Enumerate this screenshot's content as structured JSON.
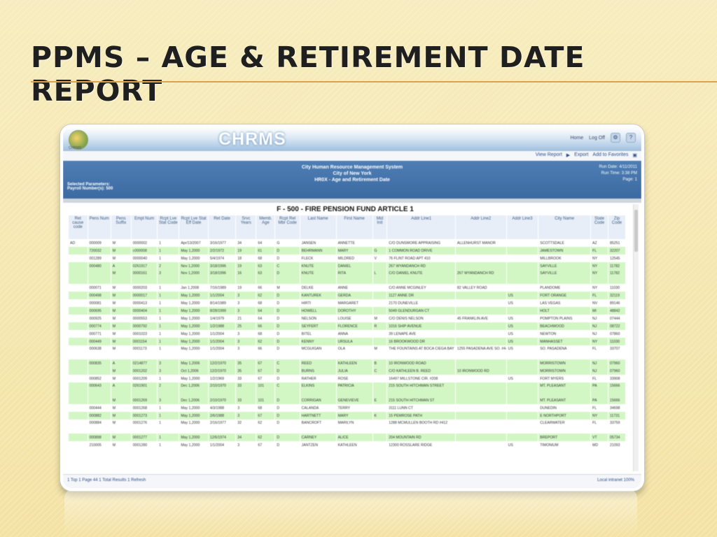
{
  "slide": {
    "title": "PPMS – AGE & RETIREMENT DATE REPORT"
  },
  "app": {
    "brand": "CHRMS",
    "logo_text": "CHRMS",
    "top_links": [
      "Home",
      "Log Off"
    ],
    "toolbar": {
      "view": "View Report",
      "export": "Export",
      "add_to_favorites": "Add to Favorites"
    },
    "header": {
      "line1": "City Human Resource Management System",
      "line2": "City of New York",
      "line3": "HR0X - Age and Retirement Date",
      "params_label": "Selected Parameters:",
      "payroll_label": "Payroll Number(s): 500",
      "run_date": "Run Date: 4/11/2011",
      "run_time": "Run Time: 3:38 PM",
      "page": "Page: 1"
    },
    "report_title": "F - 500 - FIRE PENSION FUND ARTICLE 1",
    "columns": [
      "Ret cause code",
      "Pens Num",
      "Pens Suffix",
      "Empl Num",
      "Rcpt Lve Stat Code",
      "Rcpt Lve Stat Eff Date",
      "Ret Date",
      "Srvc Years",
      "Memb. Age",
      "Rcpt Rel Mbr Code",
      "Last Name",
      "First Name",
      "Mid Init",
      "Addr Line1",
      "Addr Line2",
      "Addr Line3",
      "City Name",
      "State Code",
      "Zip Code"
    ],
    "rows": [
      {
        "style": "white",
        "cells": [
          "AD",
          "000009",
          "M",
          "0000002",
          "1",
          "Apr/13/2007",
          "3/16/1977",
          "34",
          "64",
          "G",
          "JANSEN",
          "ANNETTE",
          "",
          "C/O DUNSMORE APPRAISING",
          "ALLENHURST MANOR",
          "",
          "SCOTTSDALE",
          "AZ",
          "85251"
        ]
      },
      {
        "style": "green",
        "cells": [
          "",
          "720032",
          "M",
          "c000008",
          "1",
          "May 1,2000",
          "2/2/1972",
          "19",
          "61",
          "D",
          "BEHRMANN",
          "MARY",
          "G",
          "1 COMMON ROAD DRIVE",
          "",
          "",
          "JAMESTOWN",
          "FL",
          "32207"
        ]
      },
      {
        "style": "white",
        "cells": [
          "",
          "001289",
          "M",
          "0000040",
          "1",
          "May 1,2000",
          "5/4/1974",
          "18",
          "68",
          "D",
          "FLECK",
          "MILDRED",
          "V",
          "76 FLINT ROAD APT 410",
          "",
          "",
          "MILLBROOK",
          "NY",
          "12545"
        ]
      },
      {
        "style": "green",
        "cells": [
          "",
          "000480",
          "A",
          "0261917",
          "2",
          "Nov 1,2000",
          "3/18/1996",
          "19",
          "63",
          "C",
          "KNUTE",
          "DANIEL",
          "",
          "267 WYANDANCH RD",
          "",
          "",
          "SAYVILLE",
          "NY",
          "11782"
        ]
      },
      {
        "style": "green tall",
        "cells": [
          "",
          "",
          "M",
          "0000161",
          "3",
          "Nov 1,2000",
          "3/18/1996",
          "16",
          "63",
          "D",
          "KNUTE",
          "RITA",
          "L",
          "C/O DANIEL KNUTE",
          "267 WYANDANCH RD",
          "",
          "SAYVILLE",
          "NY",
          "11782"
        ]
      },
      {
        "style": "white",
        "cells": [
          "",
          "000071",
          "M",
          "0000203",
          "1",
          "Jan 1,2008",
          "7/16/1989",
          "19",
          "66",
          "M",
          "DELKE",
          "ANNE",
          "",
          "C/O ANNE MCGINLEY",
          "82 VALLEY ROAD",
          "",
          "PLANDOME",
          "NY",
          "11030"
        ]
      },
      {
        "style": "green",
        "cells": [
          "",
          "000498",
          "M",
          "0000017",
          "1",
          "May 1,2000",
          "1/1/2004",
          "3",
          "62",
          "D",
          "KANTUREK",
          "GERDA",
          "",
          "1127 ANNE DR",
          "",
          "US",
          "FORT ORANGE",
          "FL",
          "32119"
        ]
      },
      {
        "style": "white",
        "cells": [
          "",
          "000081",
          "M",
          "0000413",
          "1",
          "May 1,2000",
          "8/14/1989",
          "3",
          "68",
          "D",
          "HIRTI",
          "MARGARET",
          "",
          "2170 DUNEVILLE",
          "",
          "US",
          "LAS VEGAS",
          "NV",
          "89146"
        ]
      },
      {
        "style": "green",
        "cells": [
          "",
          "000695",
          "M",
          "0000404",
          "1",
          "May 1,2000",
          "8/28/1999",
          "3",
          "64",
          "D",
          "HOWELL",
          "DOROTHY",
          "",
          "5049 GLENDURGAN CT",
          "",
          "",
          "HOLT",
          "MI",
          "48842"
        ]
      },
      {
        "style": "white",
        "cells": [
          "",
          "000925",
          "M",
          "0000553",
          "1",
          "May 1,2000",
          "1/4/1979",
          "21",
          "64",
          "D",
          "NELSON",
          "LOUISE",
          "M",
          "C/O DENIS NELSON",
          "45 FRANKLIN AVE",
          "US",
          "POMPTON PLAINS",
          "NJ",
          "07444"
        ]
      },
      {
        "style": "green",
        "cells": [
          "",
          "000774",
          "M",
          "0000792",
          "1",
          "May 1,2000",
          "1/2/1988",
          "25",
          "66",
          "D",
          "SEYFERT",
          "FLORENCE",
          "R",
          "1016 SHIP AVENUE",
          "",
          "US",
          "BEACHWOOD",
          "NJ",
          "08722"
        ]
      },
      {
        "style": "white",
        "cells": [
          "",
          "000771",
          "M",
          "0001023",
          "1",
          "May 1,2000",
          "1/1/2004",
          "3",
          "68",
          "D",
          "BITEL",
          "ANNA",
          "",
          "39 LENAPE AVE",
          "",
          "US",
          "NEWTON",
          "NJ",
          "07860"
        ]
      },
      {
        "style": "green",
        "cells": [
          "",
          "000449",
          "M",
          "0001154",
          "1",
          "May 1,2000",
          "1/1/2004",
          "3",
          "62",
          "D",
          "KENNY",
          "URSULA",
          "",
          "16 BROOKWOOD DR",
          "",
          "US",
          "MANHASSET",
          "NY",
          "11030"
        ]
      },
      {
        "style": "white tall",
        "cells": [
          "",
          "000638",
          "M",
          "0001173",
          "1",
          "May 1,2000",
          "1/1/2004",
          "3",
          "66",
          "D",
          "MCGUIGAN",
          "OLA",
          "M",
          "THE FOUNTAINS AT BOCA CIEGA BAY",
          "1255 PASADENA AVE SO. #447",
          "US",
          "SO. PASADENA",
          "FL",
          "33707"
        ]
      },
      {
        "style": "green",
        "cells": [
          "",
          "000835",
          "A",
          "0214877",
          "3",
          "May 1,2006",
          "12/2/1970",
          "35",
          "67",
          "C",
          "REED",
          "KATHLEEN",
          "B",
          "10 IRONWOOD ROAD",
          "",
          "",
          "MORRISTOWN",
          "NJ",
          "07960"
        ]
      },
      {
        "style": "green",
        "cells": [
          "",
          "",
          "M",
          "0001202",
          "3",
          "Oct 1,2006",
          "12/2/1970",
          "35",
          "67",
          "D",
          "BURNS",
          "JULIA",
          "C",
          "C/O KATHLEEN B. REED",
          "10 IRONWOOD RD",
          "",
          "MORRISTOWN",
          "NJ",
          "07960"
        ]
      },
      {
        "style": "white",
        "cells": [
          "",
          "000852",
          "M",
          "0001209",
          "1",
          "May 1,2000",
          "1/2/1969",
          "33",
          "67",
          "D",
          "RATHER",
          "ROSE",
          "",
          "16497 MILLSTONE CIR. #208",
          "",
          "US",
          "FORT MYERS",
          "FL",
          "33908"
        ]
      },
      {
        "style": "green tall",
        "cells": [
          "",
          "000643",
          "A",
          "0261901",
          "2",
          "Dec 1,2006",
          "2/10/1970",
          "33",
          "101",
          "C",
          "ELKINS",
          "PATRICIA",
          "",
          "215 SOUTH HITCHMAN STREET",
          "",
          "",
          "MT. PLEASANT",
          "PA",
          "15666"
        ]
      },
      {
        "style": "green",
        "cells": [
          "",
          "",
          "M",
          "0001269",
          "3",
          "Dec 1,2006",
          "2/10/1970",
          "33",
          "101",
          "D",
          "CORRIGAN",
          "GENEVIEVE",
          "E",
          "215 SOUTH HITCHMAN ST",
          "",
          "",
          "MT. PLEASANT",
          "PA",
          "15666"
        ]
      },
      {
        "style": "white",
        "cells": [
          "",
          "000444",
          "M",
          "0001268",
          "1",
          "May 1,2000",
          "4/3/1988",
          "3",
          "68",
          "D",
          "CALANDA",
          "TERRY",
          "",
          "3111 LUNN CT",
          "",
          "",
          "DUNEDIN",
          "FL",
          "34698"
        ]
      },
      {
        "style": "green",
        "cells": [
          "",
          "000882",
          "M",
          "0001273",
          "1",
          "May 1,2000",
          "2/6/1988",
          "3",
          "67",
          "D",
          "HARTNETT",
          "MARY",
          "K",
          "15 PEMROSE PATH",
          "",
          "",
          "E NORTHPORT",
          "NY",
          "11731"
        ]
      },
      {
        "style": "white tall",
        "cells": [
          "",
          "000884",
          "M",
          "0001276",
          "1",
          "May 1,2000",
          "2/16/1977",
          "32",
          "62",
          "D",
          "BANCROFT",
          "MARILYN",
          "",
          "1288 MCMULLEN BOOTH RD #412",
          "",
          "",
          "CLEARWATER",
          "FL",
          "33759"
        ]
      },
      {
        "style": "green",
        "cells": [
          "",
          "000898",
          "M",
          "0001277",
          "1",
          "May 1,2000",
          "12/6/1974",
          "34",
          "62",
          "D",
          "CARNEY",
          "ALICE",
          "",
          "204 MOUNTAIN RD",
          "",
          "",
          "BREPORT",
          "VT",
          "05734"
        ]
      },
      {
        "style": "white",
        "cells": [
          "",
          "210005",
          "M",
          "0001280",
          "1",
          "May 1,2000",
          "1/1/2004",
          "3",
          "67",
          "D",
          "JANTZEN",
          "KATHLEEN",
          "",
          "12300 ROSSLARE RIDGE",
          "",
          "US",
          "TIMONIUM",
          "MD",
          "21093"
        ]
      }
    ],
    "footer": {
      "left": "1 Top  1 Page 44  1 Total Results  1 Refresh",
      "right": "Local intranet   100%"
    }
  }
}
